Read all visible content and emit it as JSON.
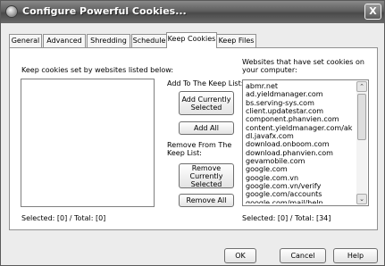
{
  "window": {
    "title": "Configure Powerful Cookies...",
    "close_label": "X"
  },
  "tabs": [
    {
      "label": "General"
    },
    {
      "label": "Advanced"
    },
    {
      "label": "Shredding"
    },
    {
      "label": "Schedule"
    },
    {
      "label": "Keep Cookies"
    },
    {
      "label": "Keep Files"
    }
  ],
  "active_tab": "Keep Cookies",
  "keep_list": {
    "label": "Keep cookies set by websites listed below:",
    "items": [],
    "status": "Selected: [0] / Total: [0]"
  },
  "actions": {
    "add_heading": "Add To The Keep List:",
    "add_current_label": "Add Currently\nSelected",
    "add_all_label": "Add All",
    "remove_heading": "Remove From The\nKeep List:",
    "remove_current_label": "Remove Currently\nSelected",
    "remove_all_label": "Remove All"
  },
  "websites": {
    "label": "Websites that have set cookies on\nyour computer:",
    "items": [
      "abmr.net",
      "ad.yieldmanager.com",
      "bs.serving-sys.com",
      "client.updatestar.com",
      "component.phanvien.com",
      "content.yieldmanager.com/ak",
      "dl.javafx.com",
      "download.onboom.com",
      "download.phanvien.com",
      "gevamobile.com",
      "google.com",
      "google.com.vn",
      "google.com.vn/verify",
      "google.com/accounts",
      "google.com/mail/help"
    ],
    "status": "Selected: [0] / Total: [34]"
  },
  "scroll_icons": {
    "up": "chevron-up-icon",
    "down": "chevron-down-icon"
  },
  "footer": {
    "ok_label": "OK",
    "cancel_label": "Cancel",
    "help_label": "Help"
  }
}
